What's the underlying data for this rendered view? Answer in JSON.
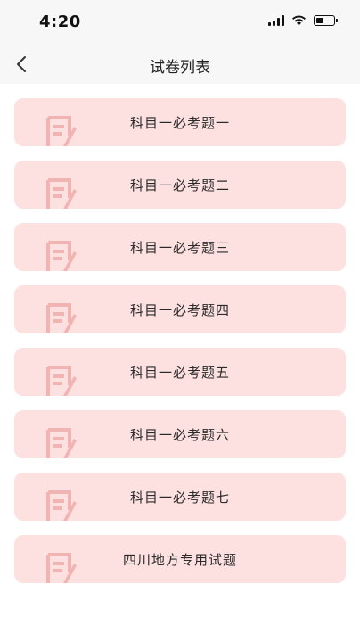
{
  "status_bar": {
    "time": "4:20",
    "battery_level": 0.45
  },
  "nav": {
    "title": "试卷列表",
    "back_icon": "chevron-left-icon"
  },
  "exams": [
    {
      "label": "科目一必考题一"
    },
    {
      "label": "科目一必考题二"
    },
    {
      "label": "科目一必考题三"
    },
    {
      "label": "科目一必考题四"
    },
    {
      "label": "科目一必考题五"
    },
    {
      "label": "科目一必考题六"
    },
    {
      "label": "科目一必考题七"
    },
    {
      "label": "四川地方专用试题"
    }
  ],
  "colors": {
    "card_bg": "#fde1e1",
    "deco": "#f2b3b3",
    "bar_bg": "#f7f7f7"
  }
}
